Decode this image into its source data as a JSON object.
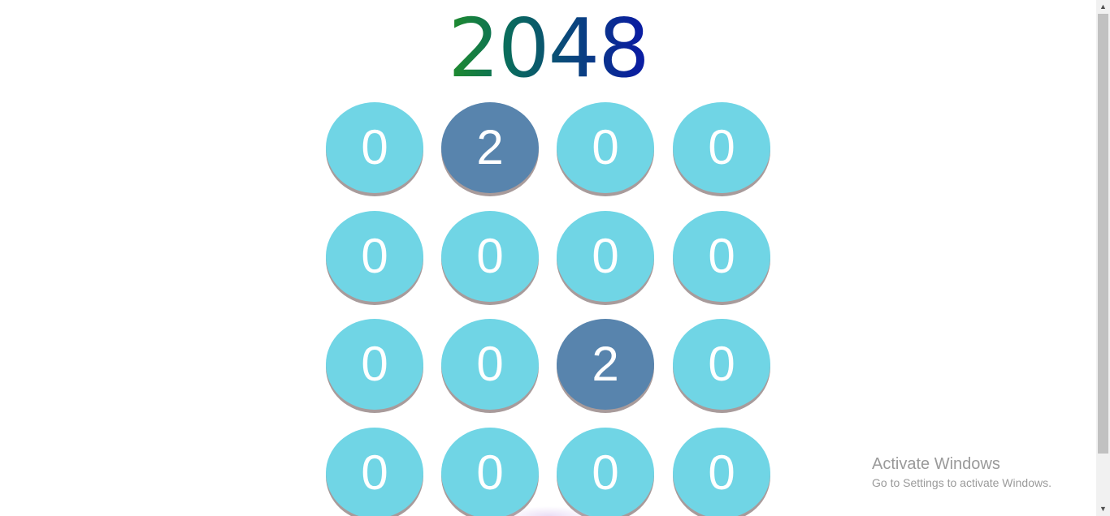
{
  "game": {
    "title": "2048",
    "tiles": [
      [
        "0",
        "2",
        "0",
        "0"
      ],
      [
        "0",
        "0",
        "0",
        "0"
      ],
      [
        "0",
        "0",
        "2",
        "0"
      ],
      [
        "0",
        "0",
        "0",
        "0"
      ]
    ],
    "colors": {
      "empty_tile": "#70d5e5",
      "two_tile": "#5884ad",
      "tile_text": "#ffffff",
      "tile_shadow": "#a89b9b"
    }
  },
  "watermark": {
    "title": "Activate Windows",
    "subtitle": "Go to Settings to activate Windows."
  },
  "scrollbar": {
    "up_icon": "▲",
    "down_icon": "▼"
  }
}
